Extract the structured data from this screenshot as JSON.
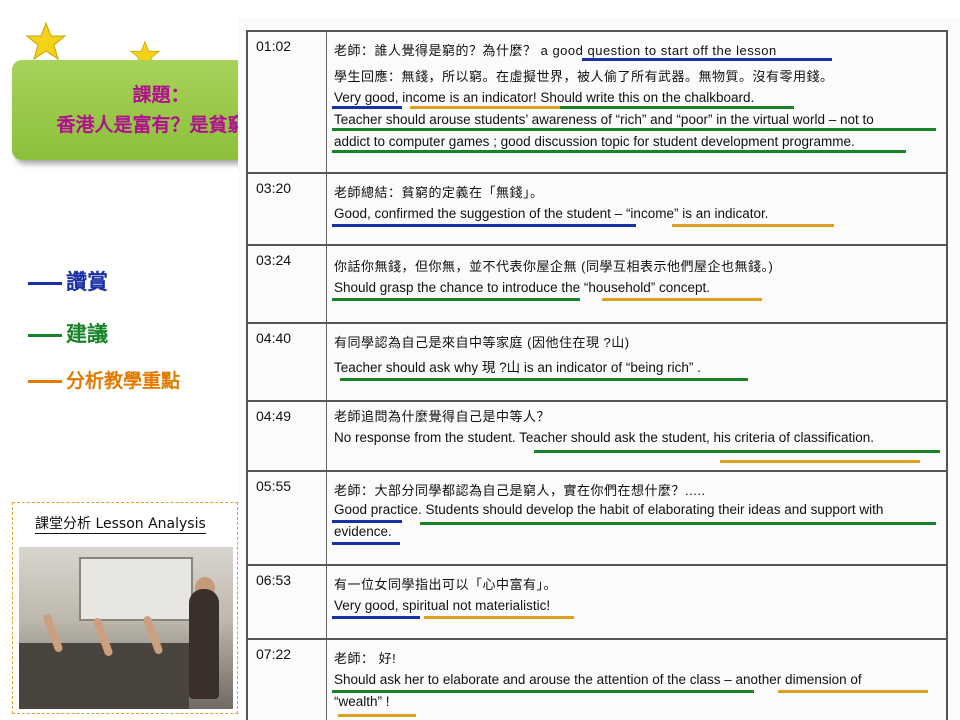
{
  "topic": {
    "line1": "課題：",
    "line2": "香港人是富有？是貧窮？"
  },
  "legend": {
    "praise": "讚賞",
    "suggestion": "建議",
    "analysis": "分析教學重點"
  },
  "analysis_panel": {
    "title": "課堂分析  Lesson Analysis"
  },
  "colors": {
    "praise": "#1b2fa8",
    "suggestion": "#18842a",
    "analysis": "#e07b00",
    "topic_bg": "#9cc94a",
    "topic_text": "#b01090"
  },
  "rows": [
    {
      "time": "01:02",
      "lines": [
        "老師：誰人覺得是窮的？為什麼？  a good question to start off the lesson",
        "學生回應：無錢，所以窮。在虛擬世界，被人偷了所有武器。無物質。沒有零用錢。",
        "Very good, income is an indicator! Should write this on the chalkboard.",
        "Teacher should arouse students’ awareness of “rich” and “poor” in the virtual world – not to",
        "addict to computer games ; good discussion topic for student development programme."
      ]
    },
    {
      "time": "03:20",
      "lines": [
        "老師總結：貧窮的定義在「無錢」。",
        "Good, confirmed the suggestion of the student  –  “income” is an indicator."
      ]
    },
    {
      "time": "03:24",
      "lines": [
        "你話你無錢，但你無，並不代表你屋企無 (同學互相表示他們屋企也無錢。)",
        "Should grasp the chance to introduce the “household” concept."
      ]
    },
    {
      "time": "04:40",
      "lines": [
        "有同學認為自己是來自中等家庭 (因他住在現 ?山)",
        "Teacher should ask why  現 ?山  is an indicator of  “being rich” ."
      ]
    },
    {
      "time": "04:49",
      "lines": [
        "老師追問為什麼覺得自己是中等人？",
        "No response from the student. Teacher should ask the student, his criteria of classification."
      ]
    },
    {
      "time": "05:55",
      "lines": [
        "老師：大部分同學都認為自己是窮人，實在你們在想什麼？.....",
        "Good practice. Students should develop the habit of elaborating their ideas and support with",
        "evidence."
      ]
    },
    {
      "time": "06:53",
      "lines": [
        "有一位女同學指出可以「心中富有」。",
        "Very good, spiritual not materialistic!"
      ]
    },
    {
      "time": "07:22",
      "lines": [
        "老師： 好!",
        "Should ask her to elaborate and arouse the attention of the class  –  another dimension of",
        "“wealth” !"
      ]
    }
  ]
}
